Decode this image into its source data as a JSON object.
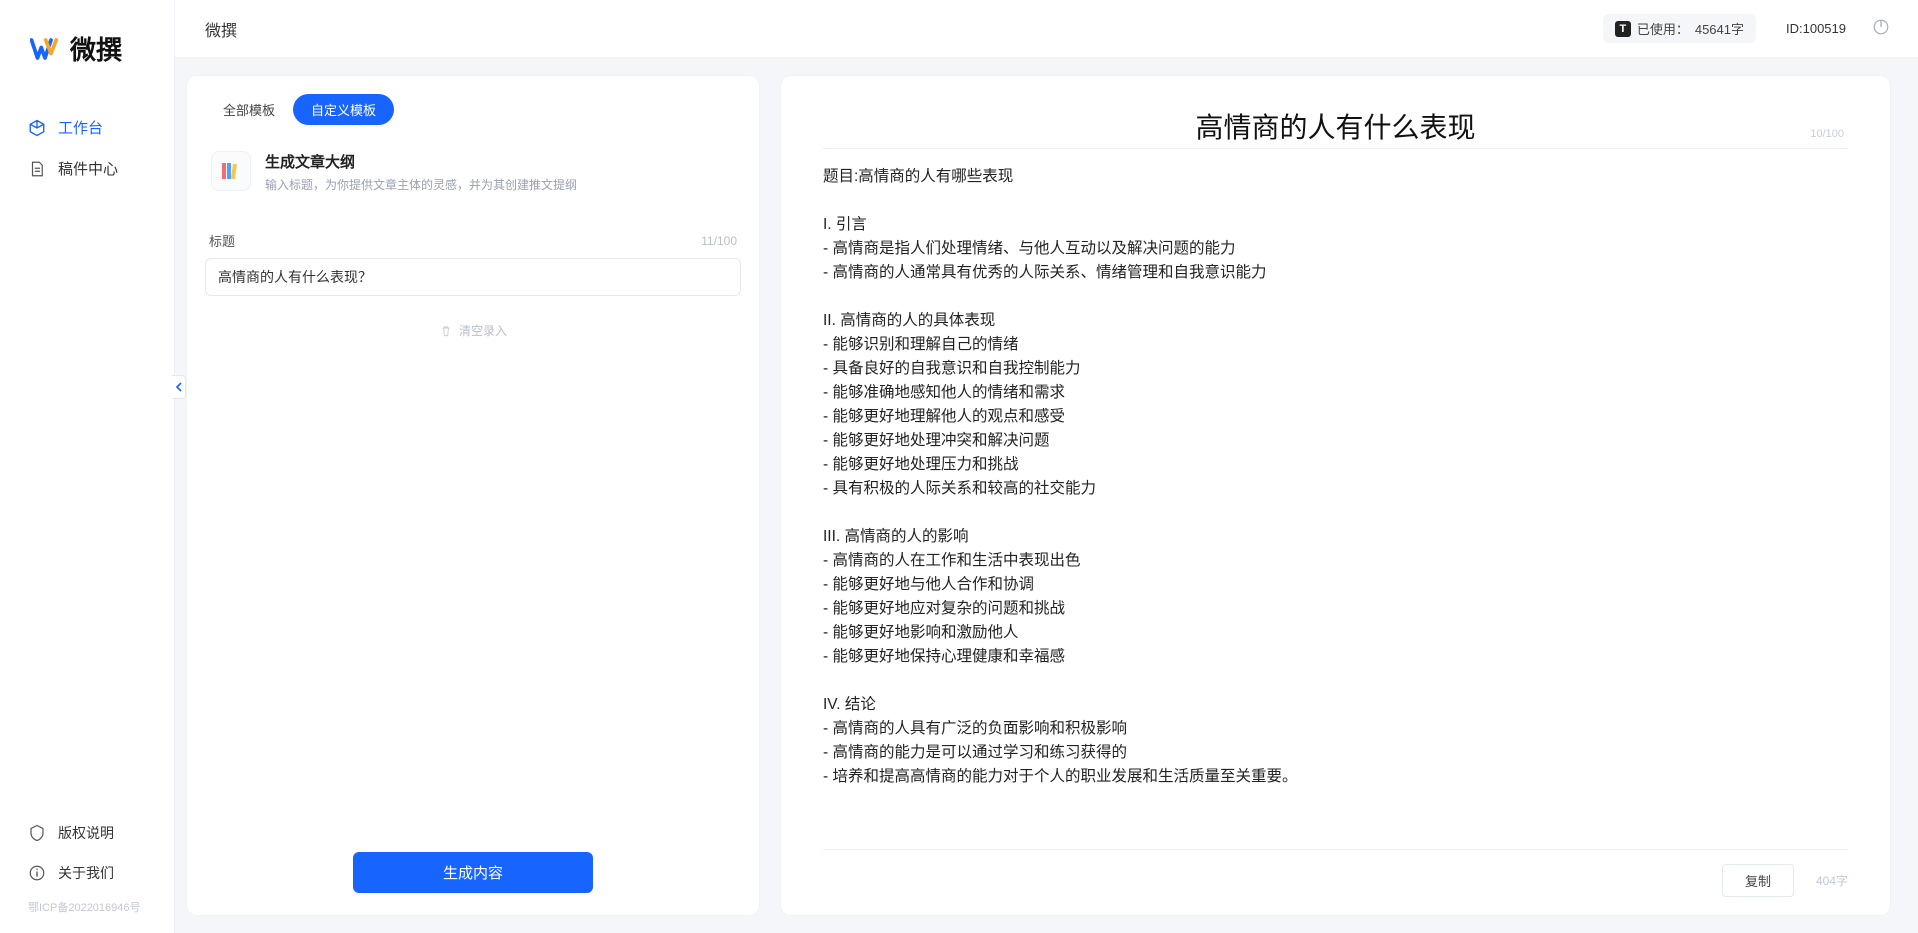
{
  "brand": {
    "name": "微撰"
  },
  "sidebar": {
    "items": [
      {
        "label": "工作台"
      },
      {
        "label": "稿件中心"
      }
    ],
    "bottom": [
      {
        "label": "版权说明"
      },
      {
        "label": "关于我们"
      }
    ],
    "icp": "鄂ICP备2022016946号"
  },
  "topbar": {
    "title": "微撰",
    "usage_prefix": "已使用：",
    "usage_value": "45641字",
    "id_label": "ID:100519"
  },
  "left": {
    "tabs": [
      {
        "label": "全部模板"
      },
      {
        "label": "自定义模板"
      }
    ],
    "template": {
      "title": "生成文章大纲",
      "desc": "输入标题，为你提供文章主体的灵感，并为其创建推文提纲"
    },
    "title_label": "标题",
    "title_counter": "11/100",
    "title_value": "高情商的人有什么表现？",
    "clear_label": "清空录入",
    "generate_label": "生成内容"
  },
  "right": {
    "title": "高情商的人有什么表现",
    "title_counter": "10/100",
    "body": "题目:高情商的人有哪些表现\n\nI. 引言\n- 高情商是指人们处理情绪、与他人互动以及解决问题的能力\n- 高情商的人通常具有优秀的人际关系、情绪管理和自我意识能力\n\nII. 高情商的人的具体表现\n- 能够识别和理解自己的情绪\n- 具备良好的自我意识和自我控制能力\n- 能够准确地感知他人的情绪和需求\n- 能够更好地理解他人的观点和感受\n- 能够更好地处理冲突和解决问题\n- 能够更好地处理压力和挑战\n- 具有积极的人际关系和较高的社交能力\n\nIII. 高情商的人的影响\n- 高情商的人在工作和生活中表现出色\n- 能够更好地与他人合作和协调\n- 能够更好地应对复杂的问题和挑战\n- 能够更好地影响和激励他人\n- 能够更好地保持心理健康和幸福感\n\nIV. 结论\n- 高情商的人具有广泛的负面影响和积极影响\n- 高情商的能力是可以通过学习和练习获得的\n- 培养和提高高情商的能力对于个人的职业发展和生活质量至关重要。",
    "copy_label": "复制",
    "word_count": "404字"
  }
}
